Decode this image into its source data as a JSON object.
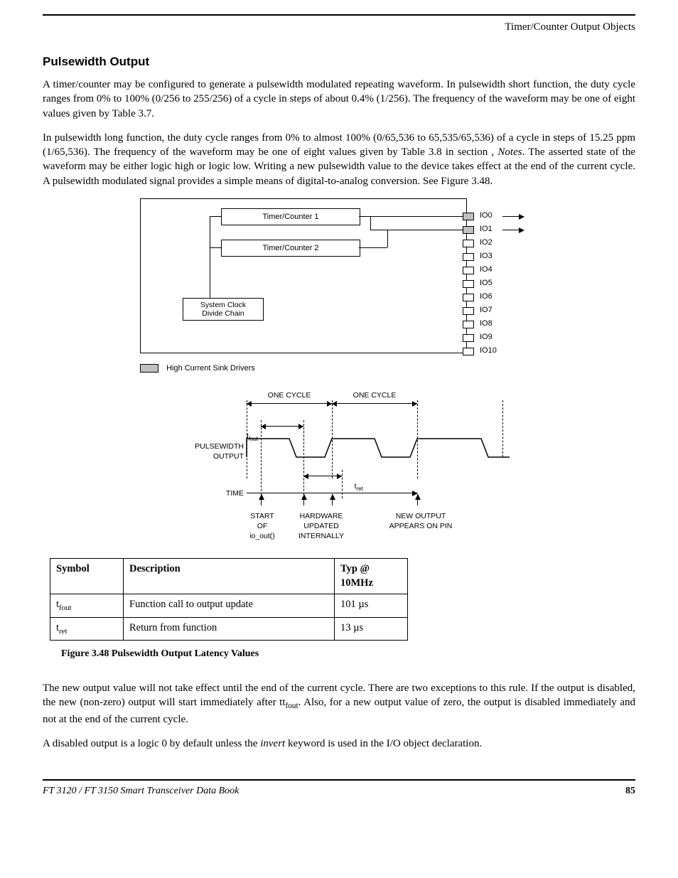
{
  "header": {
    "running": "Timer/Counter Output Objects"
  },
  "section": {
    "title": "Pulsewidth Output",
    "p1": "A timer/counter may be configured to generate a pulsewidth modulated repeating waveform. In pulsewidth short function, the duty cycle ranges from 0% to 100% (0/256 to 255/256) of a cycle in steps of about 0.4% (1/256). The frequency of the waveform may be one of eight values given by Table 3.7.",
    "p2_a": "In pulsewidth long function, the duty cycle ranges from 0% to almost 100% (0/65,536 to 65,535/65,536) of a cycle in steps of 15.25 ppm (1/65,536). The frequency of the waveform may be one of eight values given by Table 3.8 in section , ",
    "p2_notes": "Notes",
    "p2_b": ". The asserted state of the waveform may be either logic high or logic low. Writing a new pulsewidth value to the device takes effect at the end of the current cycle. A pulsewidth modulated signal provides a simple means of digital-to-analog conversion. See Figure 3.48."
  },
  "block_diagram": {
    "tc1": "Timer/Counter 1",
    "tc2": "Timer/Counter 2",
    "clk": "System Clock\nDivide Chain",
    "legend": "High Current Sink Drivers",
    "io": [
      "IO0",
      "IO1",
      "IO2",
      "IO3",
      "IO4",
      "IO5",
      "IO6",
      "IO7",
      "IO8",
      "IO9",
      "IO10"
    ]
  },
  "timing": {
    "cycle": "ONE CYCLE",
    "tfout": "t",
    "tfout_sub": "fout",
    "tret": "t",
    "tret_sub": "ret",
    "pw_out": "PULSEWIDTH\nOUTPUT",
    "time": "TIME",
    "start": "START\nOF\nio_out()",
    "hw": "HARDWARE\nUPDATED\nINTERNALLY",
    "newout": "NEW OUTPUT\nAPPEARS ON PIN"
  },
  "table": {
    "h1": "Symbol",
    "h2": "Description",
    "h3": "Typ @ 10MHz",
    "rows": [
      {
        "sym": "t",
        "sub": "fout",
        "desc": "Function call to output update",
        "typ": "101 µs"
      },
      {
        "sym": "t",
        "sub": "ret",
        "desc": "Return from function",
        "typ": "13 µs"
      }
    ]
  },
  "figure_caption": "Figure 3.48  Pulsewidth Output Latency Values",
  "para3_a": "The new output value will not take effect until the end of the current cycle. There are two exceptions to this rule. If the output is disabled, the new (non-zero) output will start immediately after t",
  "para3_sub": "fout",
  "para3_b": ". Also, for a new output value of zero, the output is disabled immediately and not at the end of the current cycle.",
  "para4_a": "A disabled output is a logic 0 by default unless the ",
  "para4_kw": "invert",
  "para4_b": " keyword is used in the I/O object declaration.",
  "footer": {
    "title": "FT 3120 / FT 3150 Smart Transceiver Data Book",
    "page": "85"
  }
}
